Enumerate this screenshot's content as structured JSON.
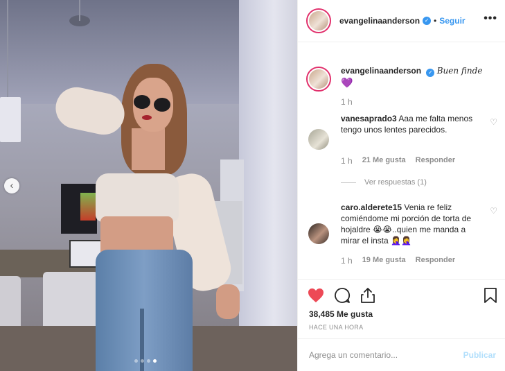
{
  "header": {
    "username": "evangelinaanderson",
    "separator": "•",
    "follow_label": "Seguir",
    "more_label": "•••"
  },
  "caption": {
    "username": "evangelinaanderson",
    "text": "Buen finde",
    "emoji": "💜",
    "time": "1 h"
  },
  "comments": [
    {
      "username": "vanesaprado3",
      "text": "Aaa me falta menos tengo unos lentes parecidos.",
      "time": "1 h",
      "likes": "21 Me gusta",
      "reply": "Responder"
    },
    {
      "username": "caro.alderete15",
      "text": "Venia re feliz comiéndome mi porción de torta de hojaldre 😭😭..quien me manda a mirar el insta 🤦‍♀️🤦‍♀️",
      "time": "1 h",
      "likes": "19 Me gusta",
      "reply": "Responder"
    }
  ],
  "view_replies": "Ver respuestas (1)",
  "likes_count": "38,485 Me gusta",
  "posted_time": "HACE UNA HORA",
  "add_comment": {
    "placeholder": "Agrega un comentario...",
    "publish": "Publicar"
  },
  "carousel": {
    "prev_label": "‹",
    "total": 4,
    "active": 4
  },
  "colors": {
    "accent": "#3897f0",
    "like_red": "#ed4956",
    "muted": "#8e8e8e",
    "publish_disabled": "#b2dffc"
  },
  "icons": [
    "heart-icon",
    "comment-icon",
    "share-icon",
    "bookmark-icon",
    "verified-icon",
    "more-icon",
    "chevron-left-icon",
    "like-small-icon"
  ]
}
